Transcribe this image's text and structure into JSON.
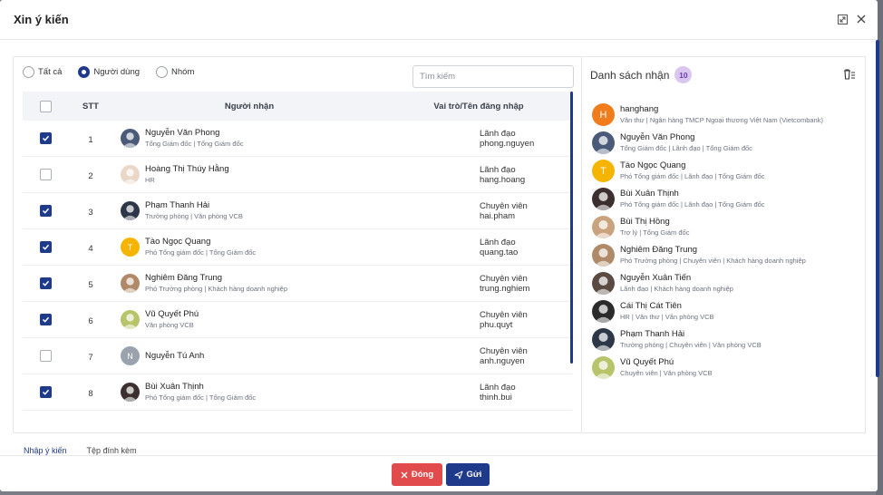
{
  "dialog": {
    "title": "Xin ý kiến"
  },
  "filter": {
    "options": [
      "Tất cả",
      "Người dùng",
      "Nhóm"
    ],
    "selected": "Người dùng",
    "search_placeholder": "Tìm kiếm"
  },
  "table": {
    "headers": {
      "stt": "STT",
      "user": "Người nhận",
      "role": "Vai trò/Tên đăng nhập"
    },
    "rows": [
      {
        "checked": true,
        "stt": "1",
        "name": "Nguyễn Văn Phong",
        "sub": "Tổng Giám đốc | Tổng Giám đốc",
        "role": "Lãnh đạo",
        "login": "phong.nguyen",
        "avatar": "photo",
        "avatar_color": "#4a5a78"
      },
      {
        "checked": false,
        "stt": "2",
        "name": "Hoàng Thị Thúy Hằng",
        "sub": "HR",
        "role": "Lãnh đạo",
        "login": "hang.hoang",
        "avatar": "photo",
        "avatar_color": "#e9d7c8"
      },
      {
        "checked": true,
        "stt": "3",
        "name": "Phạm Thanh Hải",
        "sub": "Trưởng phòng | Văn phòng VCB",
        "role": "Chuyên viên",
        "login": "hai.pham",
        "avatar": "photo",
        "avatar_color": "#2d3748"
      },
      {
        "checked": true,
        "stt": "4",
        "name": "Tào Ngọc Quang",
        "sub": "Phó Tổng giám đốc | Tổng Giám đốc",
        "role": "Lãnh đạo",
        "login": "quang.tao",
        "avatar": "T",
        "avatar_color": "#f4b400"
      },
      {
        "checked": true,
        "stt": "5",
        "name": "Nghiêm Đăng Trung",
        "sub": "Phó Trưởng phòng | Khách hàng doanh nghiệp",
        "role": "Chuyên viên",
        "login": "trung.nghiem",
        "avatar": "photo",
        "avatar_color": "#b08968"
      },
      {
        "checked": true,
        "stt": "6",
        "name": "Vũ Quyết Phú",
        "sub": "Văn phòng VCB",
        "role": "Chuyên viên",
        "login": "phu.quyt",
        "avatar": "photo",
        "avatar_color": "#b7c46a"
      },
      {
        "checked": false,
        "stt": "7",
        "name": "Nguyễn Tú Anh",
        "sub": "",
        "role": "Chuyên viên",
        "login": "anh.nguyen",
        "avatar": "N",
        "avatar_color": "#9aa3ad"
      },
      {
        "checked": true,
        "stt": "8",
        "name": "Bùi Xuân Thịnh",
        "sub": "Phó Tổng giám đốc | Tổng Giám đốc",
        "role": "Lãnh đạo",
        "login": "thinh.bui",
        "avatar": "photo",
        "avatar_color": "#3b2f2f"
      }
    ]
  },
  "recipients": {
    "title": "Danh sách nhận",
    "count": "10",
    "items": [
      {
        "name": "hanghang",
        "sub": "Văn thư | Ngân hàng TMCP Ngoại thương Việt Nam (Vietcombank)",
        "avatar": "H",
        "avatar_color": "#f07c1b"
      },
      {
        "name": "Nguyễn Văn Phong",
        "sub": "Tổng Giám đốc | Lãnh đạo | Tổng Giám đốc",
        "avatar": "photo",
        "avatar_color": "#4a5a78"
      },
      {
        "name": "Tào Ngọc Quang",
        "sub": "Phó Tổng giám đốc | Lãnh đạo | Tổng Giám đốc",
        "avatar": "T",
        "avatar_color": "#f4b400"
      },
      {
        "name": "Bùi Xuân Thịnh",
        "sub": "Phó Tổng giám đốc | Lãnh đạo | Tổng Giám đốc",
        "avatar": "photo",
        "avatar_color": "#3b2f2f"
      },
      {
        "name": "Bùi Thị Hồng",
        "sub": "Trợ lý | Tổng Giám đốc",
        "avatar": "photo",
        "avatar_color": "#c9a27e"
      },
      {
        "name": "Nghiêm Đăng Trung",
        "sub": "Phó Trưởng phòng | Chuyên viên | Khách hàng doanh nghiệp",
        "avatar": "photo",
        "avatar_color": "#b08968"
      },
      {
        "name": "Nguyễn Xuân Tiến",
        "sub": "Lãnh đạo | Khách hàng doanh nghiệp",
        "avatar": "photo",
        "avatar_color": "#5a4a42"
      },
      {
        "name": "Cái Thị Cát Tiên",
        "sub": "HR | Văn thư | Văn phòng VCB",
        "avatar": "photo",
        "avatar_color": "#2b2b2b"
      },
      {
        "name": "Phạm Thanh Hải",
        "sub": "Trưởng phòng | Chuyên viên | Văn phòng VCB",
        "avatar": "photo",
        "avatar_color": "#2d3748"
      },
      {
        "name": "Vũ Quyết Phú",
        "sub": "Chuyên viên | Văn phòng VCB",
        "avatar": "photo",
        "avatar_color": "#b7c46a"
      }
    ]
  },
  "tabs": [
    "Nhập ý kiến",
    "Tệp đính kèm"
  ],
  "buttons": {
    "close": "Đóng",
    "send": "Gửi"
  },
  "colors": {
    "primary": "#1f3a8a",
    "danger": "#e14b4b",
    "badge_bg": "#d9c7f0"
  }
}
